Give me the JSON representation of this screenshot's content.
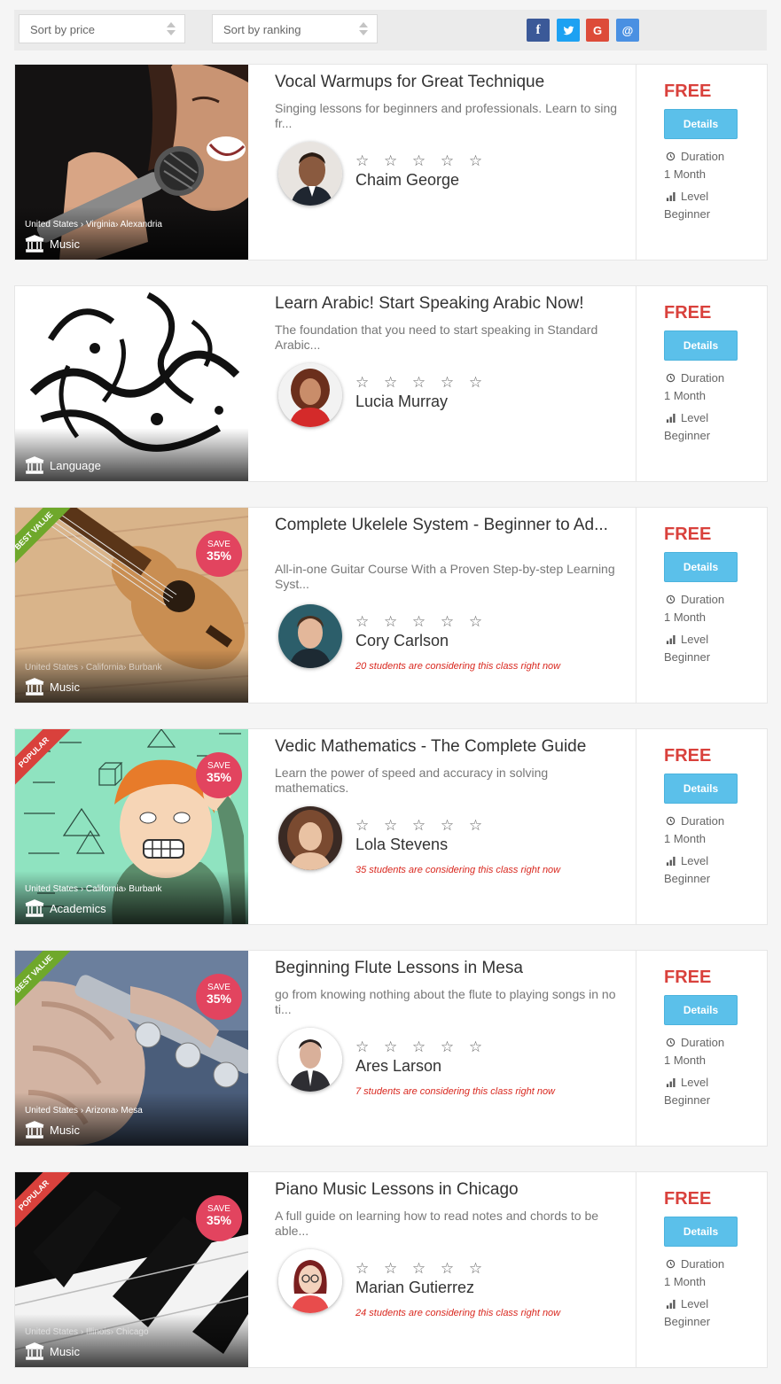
{
  "filters": {
    "sort_price": "Sort by price",
    "sort_ranking": "Sort by ranking",
    "share": [
      {
        "icon": "facebook-icon",
        "label": "f",
        "color": "#3b5998"
      },
      {
        "icon": "twitter-icon",
        "label": "t",
        "color": "#1da1f2"
      },
      {
        "icon": "google-icon",
        "label": "G",
        "color": "#dd4b39"
      },
      {
        "icon": "email-icon",
        "label": "@",
        "color": "#4a90e2"
      }
    ]
  },
  "labels": {
    "duration": "Duration",
    "level": "Level",
    "details": "Details",
    "save": "SAVE"
  },
  "courses": [
    {
      "title": "Vocal Warmups for Great Technique",
      "description": "Singing lessons for beginners and professionals. Learn to sing fr...",
      "teacher": "Chaim George",
      "rating": "☆ ☆ ☆ ☆ ☆",
      "location": "United States › Virginia› Alexandria",
      "category": "Music",
      "price": "FREE",
      "duration": "1 Month",
      "level": "Beginner",
      "considering": "",
      "ribbon": "",
      "discount": ""
    },
    {
      "title": "Learn Arabic! Start Speaking Arabic Now!",
      "description": "The foundation that you need to start speaking in Standard Arabic...",
      "teacher": "Lucia Murray",
      "rating": "☆ ☆ ☆ ☆ ☆",
      "location": "",
      "category": "Language",
      "price": "FREE",
      "duration": "1 Month",
      "level": "Beginner",
      "considering": "",
      "ribbon": "",
      "discount": ""
    },
    {
      "title": "Complete Ukelele System - Beginner to Ad...",
      "description": "All-in-one Guitar Course With a Proven Step-by-step Learning Syst...",
      "teacher": "Cory Carlson",
      "rating": "☆ ☆ ☆ ☆ ☆",
      "location": "United States › California› Burbank",
      "category": "Music",
      "price": "FREE",
      "duration": "1 Month",
      "level": "Beginner",
      "considering": "20 students are considering this class right now",
      "ribbon": "BEST VALUE",
      "discount": "35%"
    },
    {
      "title": "Vedic Mathematics - The Complete Guide",
      "description": "Learn the power of speed and accuracy in solving mathematics.",
      "teacher": "Lola Stevens",
      "rating": "☆ ☆ ☆ ☆ ☆",
      "location": "United States › California› Burbank",
      "category": "Academics",
      "price": "FREE",
      "duration": "1 Month",
      "level": "Beginner",
      "considering": "35 students are considering this class right now",
      "ribbon": "POPULAR",
      "discount": "35%"
    },
    {
      "title": "Beginning Flute Lessons in Mesa",
      "description": "go from knowing nothing about the flute to playing songs in no ti...",
      "teacher": "Ares Larson",
      "rating": "☆ ☆ ☆ ☆ ☆",
      "location": "United States › Arizona› Mesa",
      "category": "Music",
      "price": "FREE",
      "duration": "1 Month",
      "level": "Beginner",
      "considering": "7 students are considering this class right now",
      "ribbon": "BEST VALUE",
      "discount": "35%"
    },
    {
      "title": "Piano Music Lessons in Chicago",
      "description": "A full guide on learning how to read notes and chords to be able...",
      "teacher": "Marian Gutierrez",
      "rating": "☆ ☆ ☆ ☆ ☆",
      "location": "United States › Illinois› Chicago",
      "category": "Music",
      "price": "FREE",
      "duration": "1 Month",
      "level": "Beginner",
      "considering": "24 students are considering this class right now",
      "ribbon": "POPULAR",
      "discount": "35%"
    }
  ]
}
